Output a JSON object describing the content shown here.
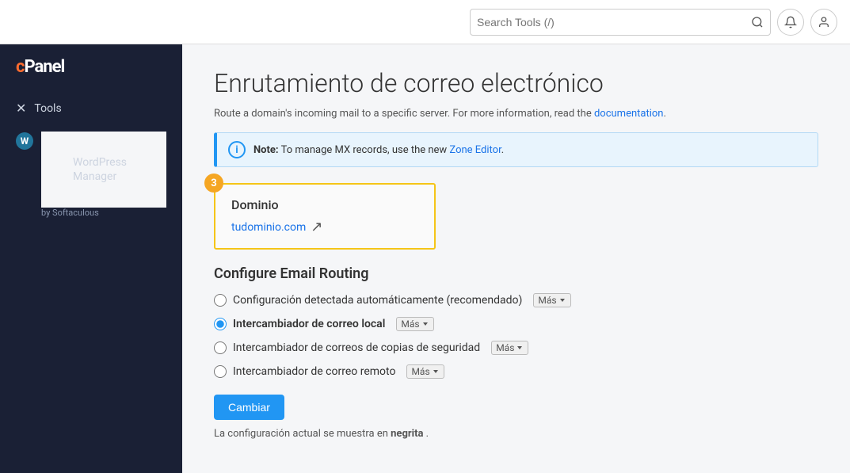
{
  "topbar": {
    "search_placeholder": "Search Tools (/)",
    "search_label": "Search Tools (/)"
  },
  "sidebar": {
    "logo": "cPanel",
    "tools_label": "Tools",
    "wp_manager_label": "WordPress Manager",
    "wp_manager_sub": "by Softaculous"
  },
  "page": {
    "title": "Enrutamiento de correo electrónico",
    "subtitle_text": "Route a domain's incoming mail to a specific server. For more information, read the",
    "subtitle_link": "documentation",
    "note_bold": "Note:",
    "note_text": "To manage MX records, use the new",
    "note_link": "Zone Editor",
    "domain_label": "Dominio",
    "domain_value": "tudominio.com",
    "badge": "3",
    "config_title": "Configure Email Routing",
    "option1": "Configuración detectada automáticamente (recomendado)",
    "option1_mas": "Más",
    "option2": "Intercambiador de correo local",
    "option2_mas": "Más",
    "option3": "Intercambiador de correos de copias de seguridad",
    "option3_mas": "Más",
    "option4": "Intercambiador de correo remoto",
    "option4_mas": "Más",
    "cambiar_label": "Cambiar",
    "config_note_prefix": "La configuración actual se muestra en",
    "config_note_bold": "negrita",
    "config_note_suffix": "."
  }
}
